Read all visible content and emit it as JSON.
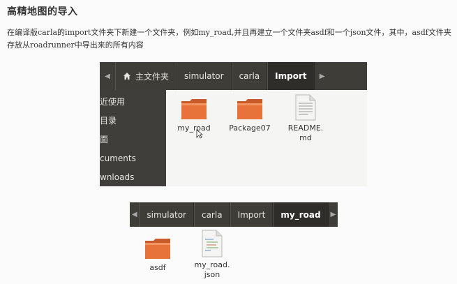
{
  "heading": "高精地图的导入",
  "paragraph": "在编译版carla的import文件夹下新建一个文件夹，例如my_road,并且再建立一个文件夹asdf和一个json文件，其中，asdf文件夹存放从roadrunner中导出来的所有内容",
  "screenshot1": {
    "breadcrumbs": [
      "主文件夹",
      "simulator",
      "carla",
      "Import"
    ],
    "sidebar": [
      "近使用",
      "目录",
      "面",
      "cuments",
      "wnloads"
    ],
    "files": [
      {
        "name": "my_road",
        "icon": "folder-icon"
      },
      {
        "name": "Package07",
        "icon": "folder-icon"
      },
      {
        "name": "README.\nmd",
        "icon": "text-file-icon"
      }
    ]
  },
  "screenshot2": {
    "breadcrumbs": [
      "simulator",
      "carla",
      "Import",
      "my_road"
    ],
    "files": [
      {
        "name": "asdf",
        "icon": "folder-icon"
      },
      {
        "name": "my_road.\njson",
        "icon": "json-file-icon"
      }
    ]
  },
  "colors": {
    "pathbar": "#3e3d38",
    "folder": "#e8733a",
    "sidebar": "#3f3e3a"
  }
}
